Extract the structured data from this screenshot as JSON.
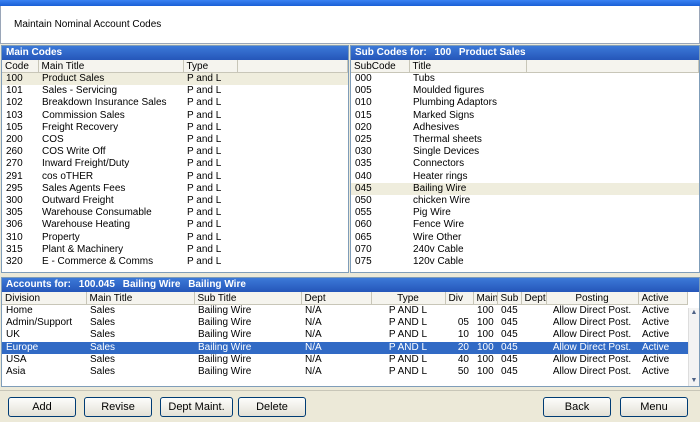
{
  "window": {
    "title": "Maintain Nominal Account Codes"
  },
  "main_codes": {
    "heading": "Main Codes",
    "columns": [
      "Code",
      "Main Title",
      "Type"
    ],
    "rows": [
      [
        "100",
        "Product Sales",
        "P and L"
      ],
      [
        "101",
        "Sales - Servicing",
        "P and L"
      ],
      [
        "102",
        "Breakdown Insurance Sales",
        "P and L"
      ],
      [
        "103",
        "Commission Sales",
        "P and L"
      ],
      [
        "105",
        "Freight Recovery",
        "P and L"
      ],
      [
        "200",
        "COS",
        "P and L"
      ],
      [
        "260",
        "COS Write Off",
        "P and L"
      ],
      [
        "270",
        "Inward Freight/Duty",
        "P and L"
      ],
      [
        "291",
        "cos oTHER",
        "P and L"
      ],
      [
        "295",
        "Sales Agents Fees",
        "P and L"
      ],
      [
        "300",
        "Outward Freight",
        "P and L"
      ],
      [
        "305",
        "Warehouse Consumable",
        "P and L"
      ],
      [
        "306",
        "Warehouse Heating",
        "P and L"
      ],
      [
        "310",
        "Property",
        "P and L"
      ],
      [
        "315",
        "Plant & Machinery",
        "P and L"
      ],
      [
        "320",
        "E - Commerce & Comms",
        "P and L"
      ]
    ]
  },
  "sub_codes": {
    "heading_prefix": "Sub Codes for:",
    "code": "100",
    "title": "Product Sales",
    "columns": [
      "SubCode",
      "Title"
    ],
    "rows": [
      [
        "000",
        "Tubs"
      ],
      [
        "005",
        "Moulded figures"
      ],
      [
        "010",
        "Plumbing Adaptors"
      ],
      [
        "015",
        "Marked Signs"
      ],
      [
        "020",
        "Adhesives"
      ],
      [
        "025",
        "Thermal sheets"
      ],
      [
        "030",
        "Single Devices"
      ],
      [
        "035",
        "Connectors"
      ],
      [
        "040",
        "Heater rings"
      ],
      [
        "045",
        "Bailing Wire"
      ],
      [
        "050",
        "chicken Wire"
      ],
      [
        "055",
        "Pig Wire"
      ],
      [
        "060",
        "Fence Wire"
      ],
      [
        "065",
        "Wire Other"
      ],
      [
        "070",
        "240v Cable"
      ],
      [
        "075",
        "120v Cable"
      ]
    ]
  },
  "accounts": {
    "heading_prefix": "Accounts for:",
    "code": "100.045",
    "sub_title": "Bailing Wire",
    "title": "Bailing Wire",
    "columns": [
      "Division",
      "Main Title",
      "Sub Title",
      "Dept",
      "Type",
      "Div",
      "Main",
      "Sub",
      "Dept",
      "Posting",
      "Active"
    ],
    "rows": [
      [
        "Home",
        "Sales",
        "Bailing Wire",
        "N/A",
        "P AND L",
        "",
        "100",
        "045",
        "",
        "Allow Direct Post.",
        "Active"
      ],
      [
        "Admin/Support",
        "Sales",
        "Bailing Wire",
        "N/A",
        "P AND L",
        "05",
        "100",
        "045",
        "",
        "Allow Direct Post.",
        "Active"
      ],
      [
        "UK",
        "Sales",
        "Bailing Wire",
        "N/A",
        "P AND L",
        "10",
        "100",
        "045",
        "",
        "Allow Direct Post.",
        "Active"
      ],
      [
        "Europe",
        "Sales",
        "Bailing Wire",
        "N/A",
        "P AND L",
        "20",
        "100",
        "045",
        "",
        "Allow Direct Post.",
        "Active"
      ],
      [
        "USA",
        "Sales",
        "Bailing Wire",
        "N/A",
        "P AND L",
        "40",
        "100",
        "045",
        "",
        "Allow Direct Post.",
        "Active"
      ],
      [
        "Asia",
        "Sales",
        "Bailing Wire",
        "N/A",
        "P AND L",
        "50",
        "100",
        "045",
        "",
        "Allow Direct Post.",
        "Active"
      ]
    ]
  },
  "buttons": {
    "add": "Add",
    "revise": "Revise",
    "dept_maint": "Dept Maint.",
    "delete": "Delete",
    "back": "Back",
    "menu": "Menu"
  },
  "icons": {
    "scroll_up": "triangle-up",
    "scroll_down": "triangle-down"
  },
  "colors": {
    "selection": "#316ac5",
    "header_bar": "#2556b9",
    "highlight_row": "#efeddd"
  }
}
